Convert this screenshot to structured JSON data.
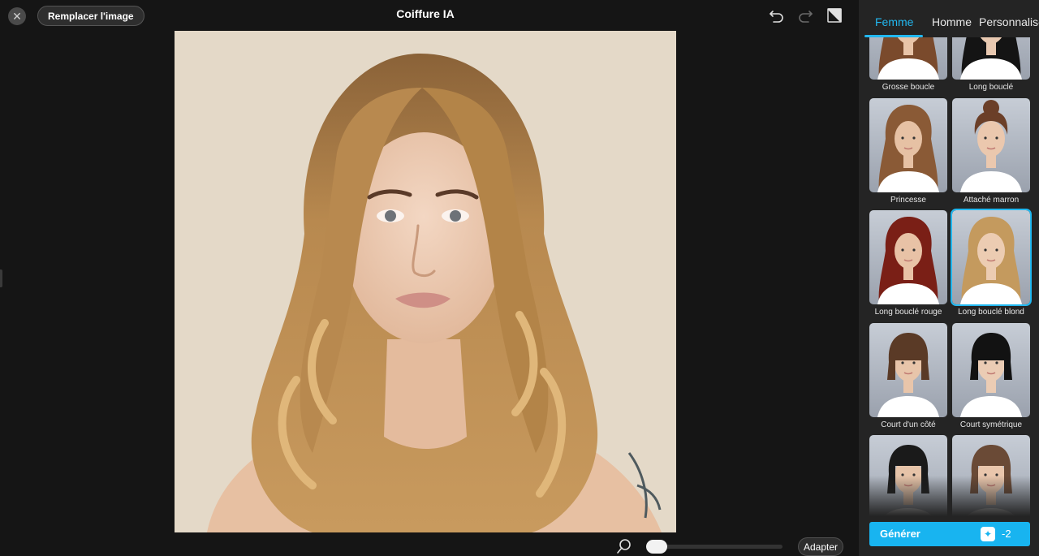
{
  "header": {
    "replace_label": "Remplacer l'image",
    "title": "Coiffure IA"
  },
  "icons": {
    "close": "close-icon",
    "undo": "undo-icon",
    "redo": "redo-icon",
    "compare": "compare-icon",
    "zoom": "zoom-icon",
    "credit": "sparkle-credit-icon"
  },
  "zoom": {
    "level": 0.0,
    "fit_label": "Adapter"
  },
  "panel": {
    "tabs": [
      {
        "label": "Femme",
        "active": true
      },
      {
        "label": "Homme",
        "active": false
      },
      {
        "label": "Personnalise",
        "active": false
      }
    ],
    "styles": [
      {
        "label": "Grosse boucle",
        "hair": "#7a4a2c",
        "len": "long",
        "skin": "#e8c4a8",
        "selected": false
      },
      {
        "label": "Long bouclé",
        "hair": "#141414",
        "len": "long",
        "skin": "#e9c9b1",
        "selected": false
      },
      {
        "label": "Princesse",
        "hair": "#8a5a36",
        "len": "long",
        "skin": "#e6c1a4",
        "selected": false
      },
      {
        "label": "Attaché marron",
        "hair": "#6b3f28",
        "len": "updo",
        "skin": "#ebc8ae",
        "selected": false
      },
      {
        "label": "Long bouclé rouge",
        "hair": "#7a1f16",
        "len": "long",
        "skin": "#e8c2a6",
        "selected": false
      },
      {
        "label": "Long bouclé blond",
        "hair": "#c49a5e",
        "len": "long",
        "skin": "#ecccb2",
        "selected": true
      },
      {
        "label": "Court d'un côté",
        "hair": "#5a3a26",
        "len": "bob",
        "skin": "#e8c5aa",
        "selected": false
      },
      {
        "label": "Court symétrique",
        "hair": "#121212",
        "len": "bob",
        "skin": "#ebccb4",
        "selected": false
      },
      {
        "label": "",
        "hair": "#1a1a1a",
        "len": "bangs",
        "skin": "#e6c3a8",
        "selected": false
      },
      {
        "label": "",
        "hair": "#6a4a36",
        "len": "bangs",
        "skin": "#e9c6ac",
        "selected": false
      }
    ]
  },
  "generate": {
    "label": "Générer",
    "credit_cost": "-2"
  },
  "colors": {
    "accent": "#22b8f0",
    "button": "#18b4f0",
    "background": "#151515",
    "panel": "#242424"
  }
}
